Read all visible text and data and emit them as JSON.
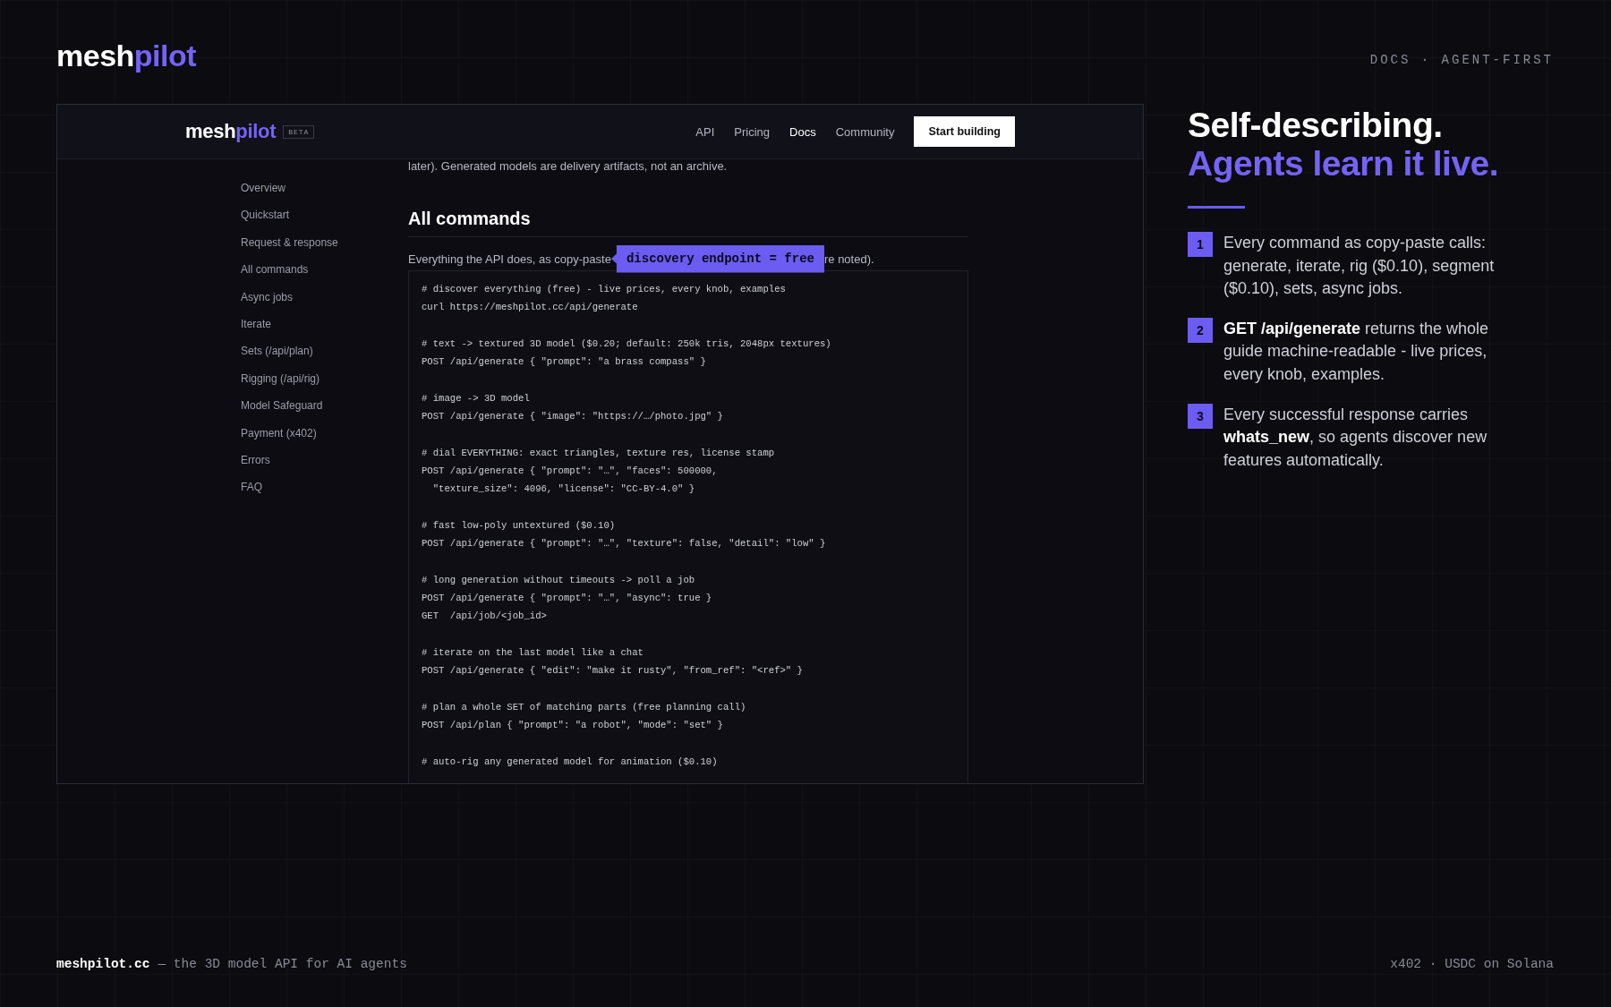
{
  "brand": {
    "text": "mesh",
    "accent": "pilot"
  },
  "tagline": "DOCS · AGENT-FIRST",
  "window": {
    "nav": {
      "logo": {
        "text": "mesh",
        "accent": "pilot"
      },
      "badge": "BETA",
      "links": [
        {
          "label": "API",
          "selected": false
        },
        {
          "label": "Pricing",
          "selected": false
        },
        {
          "label": "Docs",
          "selected": true
        },
        {
          "label": "Community",
          "selected": false
        }
      ],
      "cta": "Start building"
    },
    "sidebar": {
      "items": [
        "Overview",
        "Quickstart",
        "Request & response",
        "All commands",
        "Async jobs",
        "Iterate",
        "Sets (/api/plan)",
        "Rigging (/api/rig)",
        "Model Safeguard",
        "Payment (x402)",
        "Errors",
        "FAQ"
      ]
    },
    "content": {
      "intro_tail": "later). Generated models are delivery artifacts, not an archive.",
      "heading": "All commands",
      "lead_start": "Everything the API does, as copy-paste",
      "lead_end": "re noted).",
      "tooltip": "discovery endpoint = free",
      "code": [
        {
          "lines": [
            "# discover everything (free) - live prices, every knob, examples",
            "curl https://meshpilot.cc/api/generate"
          ]
        },
        {
          "lines": [
            "# text -> textured 3D model ($0.20; default: 250k tris, 2048px textures)",
            "POST /api/generate { \"prompt\": \"a brass compass\" }"
          ]
        },
        {
          "lines": [
            "# image -> 3D model",
            "POST /api/generate { \"image\": \"https://…/photo.jpg\" }"
          ]
        },
        {
          "lines": [
            "# dial EVERYTHING: exact triangles, texture res, license stamp",
            "POST /api/generate { \"prompt\": \"…\", \"faces\": 500000,",
            "  \"texture_size\": 4096, \"license\": \"CC-BY-4.0\" }"
          ]
        },
        {
          "lines": [
            "# fast low-poly untextured ($0.10)",
            "POST /api/generate { \"prompt\": \"…\", \"texture\": false, \"detail\": \"low\" }"
          ]
        },
        {
          "lines": [
            "# long generation without timeouts -> poll a job",
            "POST /api/generate { \"prompt\": \"…\", \"async\": true }",
            "GET  /api/job/<job_id>"
          ]
        },
        {
          "lines": [
            "# iterate on the last model like a chat",
            "POST /api/generate { \"edit\": \"make it rusty\", \"from_ref\": \"<ref>\" }"
          ]
        },
        {
          "lines": [
            "# plan a whole SET of matching parts (free planning call)",
            "POST /api/plan { \"prompt\": \"a robot\", \"mode\": \"set\" }"
          ]
        },
        {
          "lines": [
            "# auto-rig any generated model for animation ($0.10)"
          ]
        }
      ]
    }
  },
  "panel": {
    "title": "Self-describing.",
    "title_accent": "Agents learn it live.",
    "points": [
      {
        "number": "1",
        "text": "Every command as copy-paste calls: generate, iterate, rig ($0.10), segment ($0.10), sets, async jobs."
      },
      {
        "number": "2",
        "text": "**GET /api/generate** returns the whole guide machine-readable - live prices, every knob, examples."
      },
      {
        "number": "3",
        "text": "Every successful response carries **whats_new**, so agents discover new features automatically."
      }
    ]
  },
  "footer": {
    "site": "meshpilot.cc",
    "description": "— the 3D model API for AI agents",
    "payment": "x402 · USDC on Solana"
  }
}
